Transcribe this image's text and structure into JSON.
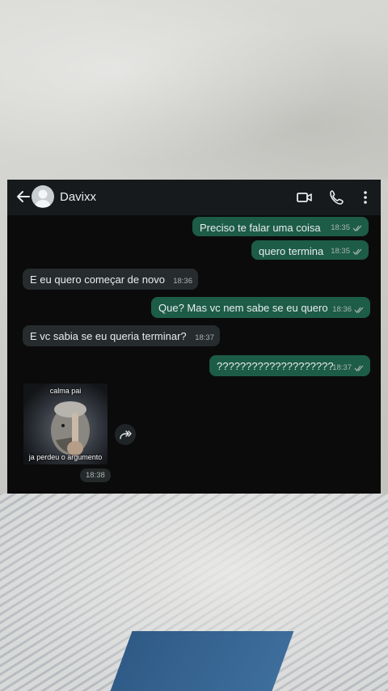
{
  "chat": {
    "contact_name": "Davixx",
    "icons": {
      "back": "arrow-left-icon",
      "avatar": "default-avatar",
      "video": "video-camera-icon",
      "call": "phone-icon",
      "menu": "more-vertical-icon"
    },
    "messages": [
      {
        "direction": "outgoing",
        "text": "Preciso te falar uma coisa",
        "time": "18:35",
        "read": true
      },
      {
        "direction": "outgoing",
        "text": "quero termina",
        "time": "18:35",
        "read": true
      },
      {
        "direction": "incoming",
        "text": "E eu quero começar de novo",
        "time": "18:36"
      },
      {
        "direction": "outgoing",
        "text": "Que? Mas vc nem sabe se eu quero",
        "time": "18:36",
        "read": true
      },
      {
        "direction": "incoming",
        "text": "E vc sabia se eu queria terminar?",
        "time": "18:37"
      },
      {
        "direction": "outgoing",
        "text": "????????????????????",
        "time": "18:37",
        "read": true
      }
    ],
    "sticker": {
      "top_caption": "calma pai",
      "bottom_caption": "ja perdeu o argumento",
      "time": "18:38",
      "forward_icon": "forward-icon"
    }
  },
  "colors": {
    "outgoing_bubble": "#1d5c47",
    "incoming_bubble": "#262b2e",
    "chat_background": "#0b0b0b",
    "header_background": "#161a1c",
    "read_tick": "#53bdeb"
  }
}
